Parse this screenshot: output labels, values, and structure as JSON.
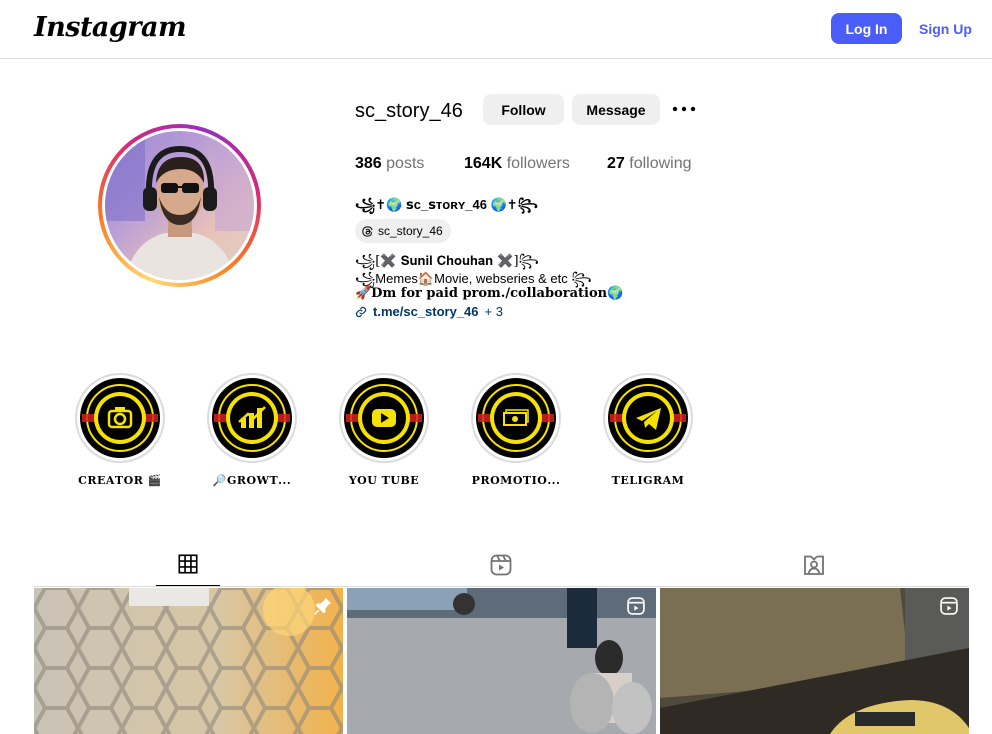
{
  "header": {
    "logo": "Instagram",
    "login_label": "Log In",
    "signup_label": "Sign Up"
  },
  "profile": {
    "username": "sc_story_46",
    "follow_label": "Follow",
    "message_label": "Message",
    "stats": {
      "posts_count": "386",
      "posts_label": "posts",
      "followers_count": "164K",
      "followers_label": "followers",
      "following_count": "27",
      "following_label": "following"
    },
    "bio": {
      "name_line": "꧁✝🌍 ꜱᴄ_ꜱᴛᴏʀʏ_46 🌍✝꧂",
      "threads_handle": "sc_story_46",
      "line1": "꧁[✖️ 𝐒𝐮𝐧𝐢𝐥 𝐂𝐡𝐨𝐮𝐡𝐚𝐧 ✖️]꧂",
      "line2": "꧁Memes🏠Movie, webseries & etc ꧂",
      "line3": "🚀𝐃𝐦 𝐟𝐨𝐫 𝐩𝐚𝐢𝐝 𝐩𝐫𝐨𝐦./𝐜𝐨𝐥𝐥𝐚𝐛𝐨𝐫𝐚𝐭𝐢𝐨𝐧🌍",
      "link_text": "t.me/sc_story_46",
      "link_more": "+ 3"
    }
  },
  "highlights": [
    {
      "label": "𝐂𝐑𝐄𝐀𝐓𝐎𝐑 🎬",
      "icon": "camera-icon"
    },
    {
      "label": "🔎𝐆𝐑𝐎𝐖𝐓...",
      "icon": "growth-chart-icon"
    },
    {
      "label": "𝐘𝐎𝐔 𝐓𝐔𝐁𝐄",
      "icon": "youtube-icon"
    },
    {
      "label": "𝐏𝐑𝐎𝐌𝐎𝐓𝐈𝐎...",
      "icon": "money-icon"
    },
    {
      "label": "𝐓𝐄𝐋𝐈𝐆𝐑𝐀𝐌",
      "icon": "telegram-icon"
    }
  ],
  "tabs": [
    {
      "name": "posts",
      "icon": "grid-icon",
      "active": true
    },
    {
      "name": "reels",
      "icon": "reels-icon",
      "active": false
    },
    {
      "name": "tagged",
      "icon": "tagged-icon",
      "active": false
    }
  ],
  "posts": [
    {
      "badge": "pin-icon"
    },
    {
      "badge": "reels-icon"
    },
    {
      "badge": "reels-icon"
    }
  ],
  "colors": {
    "accent": "#4a5df9",
    "link": "#00376b",
    "highlight_yellow": "#f5e200",
    "border": "#dbdbdb"
  }
}
